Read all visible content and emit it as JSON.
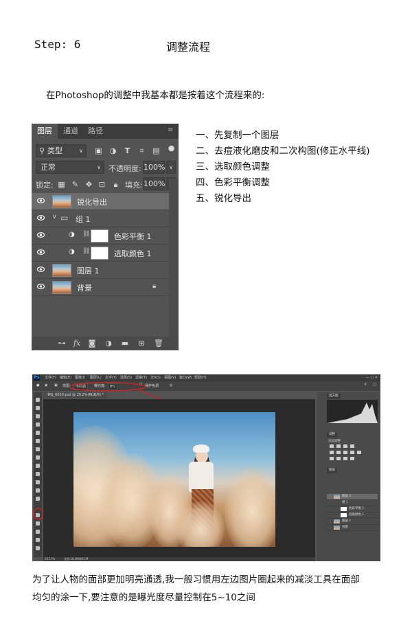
{
  "header": {
    "step": "Step: 6",
    "title": "调整流程"
  },
  "intro": "在Photoshop的调整中我基本都是按着这个流程来的:",
  "layers_panel": {
    "tabs": [
      "图层",
      "通道",
      "路径"
    ],
    "filter_kind": "类型",
    "blend_mode": "正常",
    "opacity_label": "不透明度:",
    "opacity_value": "100%",
    "lock_label": "锁定:",
    "fill_label": "填充:",
    "fill_value": "100%",
    "layers": [
      {
        "name": "锐化导出"
      },
      {
        "name": "组 1"
      },
      {
        "name": "色彩平衡 1"
      },
      {
        "name": "选取颜色 1"
      },
      {
        "name": "图层 1"
      },
      {
        "name": "背景"
      }
    ],
    "bottom_fx": "fx"
  },
  "steps": [
    "一、先复制一个图层",
    "二、去痘液化磨皮和二次构图(修正水平线)",
    "三、选取颜色调整",
    "四、色彩平衡调整",
    "五、锐化导出"
  ],
  "ps_window": {
    "logo": "Ps",
    "menus": [
      "文件(F)",
      "编辑(E)",
      "图像(I)",
      "图层(L)",
      "文字(Y)",
      "选择(S)",
      "滤镜(T)",
      "3D(D)",
      "视图(V)",
      "窗口(W)",
      "帮助(H)"
    ],
    "options": {
      "range_label": "范围:",
      "range_value": "中间调",
      "exposure_label": "曝光度:",
      "exposure_value": "8%",
      "protect_tone": "保护色调"
    },
    "doc_tab": "IMG_6659.psd @ 20.2%(RGB/8) *",
    "status_zoom": "20.17%",
    "status_doc": "文档:24.4M/86.1M",
    "right_tabs": [
      "直方图",
      "调整",
      "图层"
    ],
    "adjust_label": "添加调整",
    "layers_mini": [
      "图层 2",
      "组 1",
      "色彩平衡 1",
      "选取颜色 1",
      "图层 1",
      "背景"
    ]
  },
  "caption": {
    "line1": "为了让人物的面部更加明亮通透,我一般习惯用左边图片圈起来的减淡工具在面部",
    "line2": "均匀的涂一下,要注意的是曝光度尽量控制在5~10之间"
  }
}
